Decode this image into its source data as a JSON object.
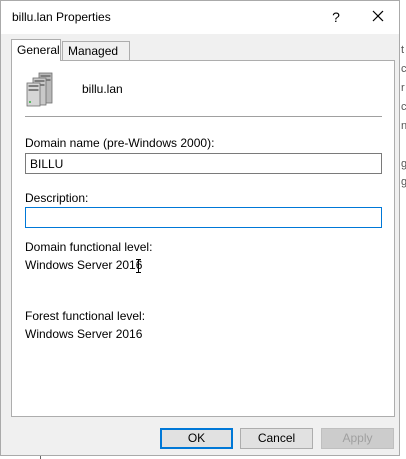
{
  "window": {
    "title": "billu.lan Properties",
    "help_label": "?",
    "close_label": "close"
  },
  "tabs": [
    {
      "label": "General",
      "selected": true
    },
    {
      "label": "Managed By",
      "selected": false
    }
  ],
  "general": {
    "domain_name": "billu.lan",
    "netbios_label": "Domain name (pre-Windows 2000):",
    "netbios_value": "BILLU",
    "description_label": "Description:",
    "description_value": "",
    "domain_level_label": "Domain functional level:",
    "domain_level_value": "Windows Server 2016",
    "forest_level_label": "Forest functional level:",
    "forest_level_value": "Windows Server 2016"
  },
  "buttons": {
    "ok": "OK",
    "cancel": "Cancel",
    "apply": "Apply"
  },
  "background": {
    "edge_chars": [
      "t",
      "c",
      "r",
      "c",
      "n",
      "g",
      "g"
    ]
  },
  "colors": {
    "focus_border": "#0078d7",
    "dialog_bg": "#f0f0f0",
    "panel_bg": "#ffffff",
    "disabled_text": "#a0a0a0"
  }
}
